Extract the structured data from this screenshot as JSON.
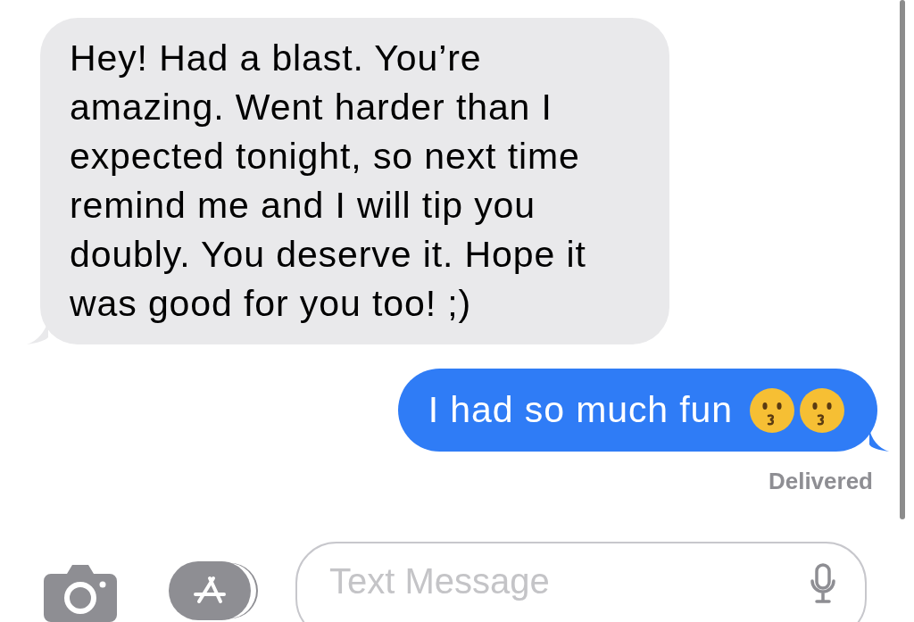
{
  "messages": [
    {
      "kind": "incoming",
      "text": "Hey! Had a blast. You’re amazing. Went harder than I expected tonight, so next time remind me and I will tip you doubly. You deserve it. Hope it was good for you too! ;)"
    },
    {
      "kind": "outgoing",
      "text": "I had so much fun"
    }
  ],
  "status": "Delivered",
  "input": {
    "placeholder": "Text Message"
  }
}
